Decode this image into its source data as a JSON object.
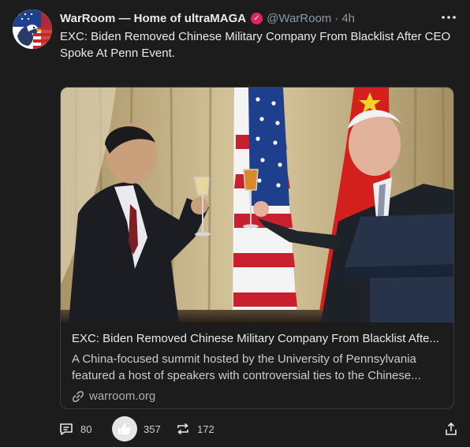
{
  "post": {
    "display_name": "WarRoom — Home of ultraMAGA",
    "verified_badge": "✓",
    "handle": "@WarRoom",
    "separator": "·",
    "time": "4h",
    "text": "EXC: Biden Removed Chinese Military Company From Blacklist After CEO Spoke At Penn Event.",
    "avatar_icon": "eagle-flag-icon",
    "more_icon": "more-options-icon"
  },
  "card": {
    "title": "EXC: Biden Removed Chinese Military Company From Blacklist Afte...",
    "description": "A China-focused summit hosted by the University of Pennsylvania featured a host of speakers with controversial ties to the Chinese...",
    "domain": "warroom.org",
    "domain_icon": "link-icon",
    "image_icon": "photo-toast-image"
  },
  "actions": {
    "reply": {
      "icon": "comment-icon",
      "count": "80"
    },
    "like": {
      "icon": "thumbs-up-icon",
      "count": "357"
    },
    "repost": {
      "icon": "repost-icon",
      "count": "172"
    },
    "share": {
      "icon": "share-icon"
    }
  },
  "colors": {
    "background": "#1c1c1c",
    "text": "#e7e9ea",
    "muted": "#8b98a5",
    "verified": "#e0245e",
    "card_border": "#3a3a3a"
  }
}
